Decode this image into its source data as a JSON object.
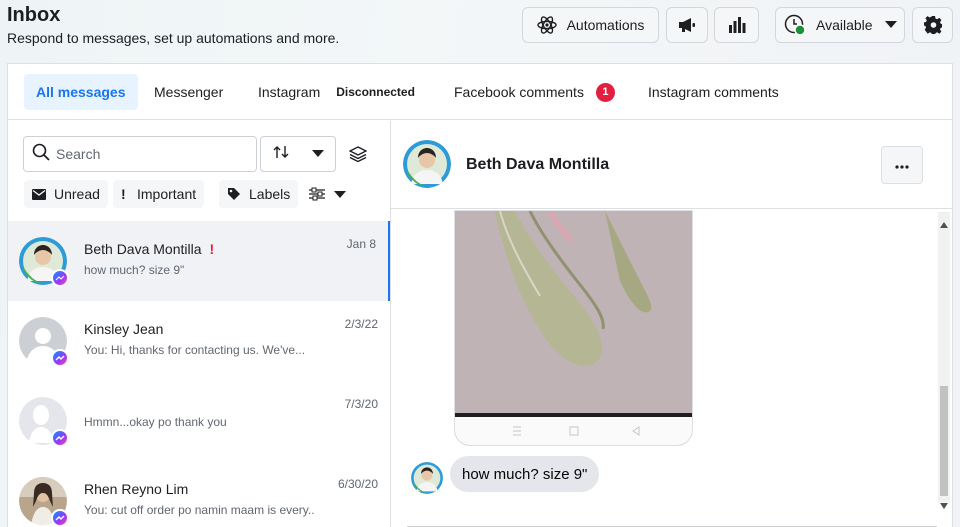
{
  "header": {
    "title": "Inbox",
    "subtitle": "Respond to messages, set up automations and more.",
    "automations_label": "Automations",
    "status_label": "Available"
  },
  "tabs": [
    {
      "label": "All messages"
    },
    {
      "label": "Messenger"
    },
    {
      "label": "Instagram",
      "badge": "Disconnected"
    },
    {
      "label": "Facebook comments",
      "count": "1"
    },
    {
      "label": "Instagram comments"
    }
  ],
  "sidebar": {
    "search_placeholder": "Search",
    "filters": [
      {
        "label": "Unread",
        "icon": "envelope-icon"
      },
      {
        "label": "Important",
        "icon": "exclamation-icon"
      },
      {
        "label": "Labels",
        "icon": "tag-icon"
      }
    ]
  },
  "conversations": [
    {
      "name": "Beth Dava Montilla",
      "important": "!",
      "preview": "how much? size 9\"",
      "date": "Jan 8"
    },
    {
      "name": "Kinsley Jean",
      "preview": "You: Hi, thanks for contacting us. We've...",
      "date": "2/3/22"
    },
    {
      "name": "",
      "preview": "Hmmn...okay po thank you",
      "date": "7/3/20"
    },
    {
      "name": "Rhen Reyno Lim",
      "preview": "You: cut off order po namin maam is every...",
      "date": "6/30/20"
    }
  ],
  "thread": {
    "contact_name": "Beth Dava Montilla",
    "last_message": "how much? size 9\""
  },
  "colors": {
    "accent": "#1876f2",
    "badge_red": "#e41e3f",
    "status_green": "#1b8f3a"
  }
}
